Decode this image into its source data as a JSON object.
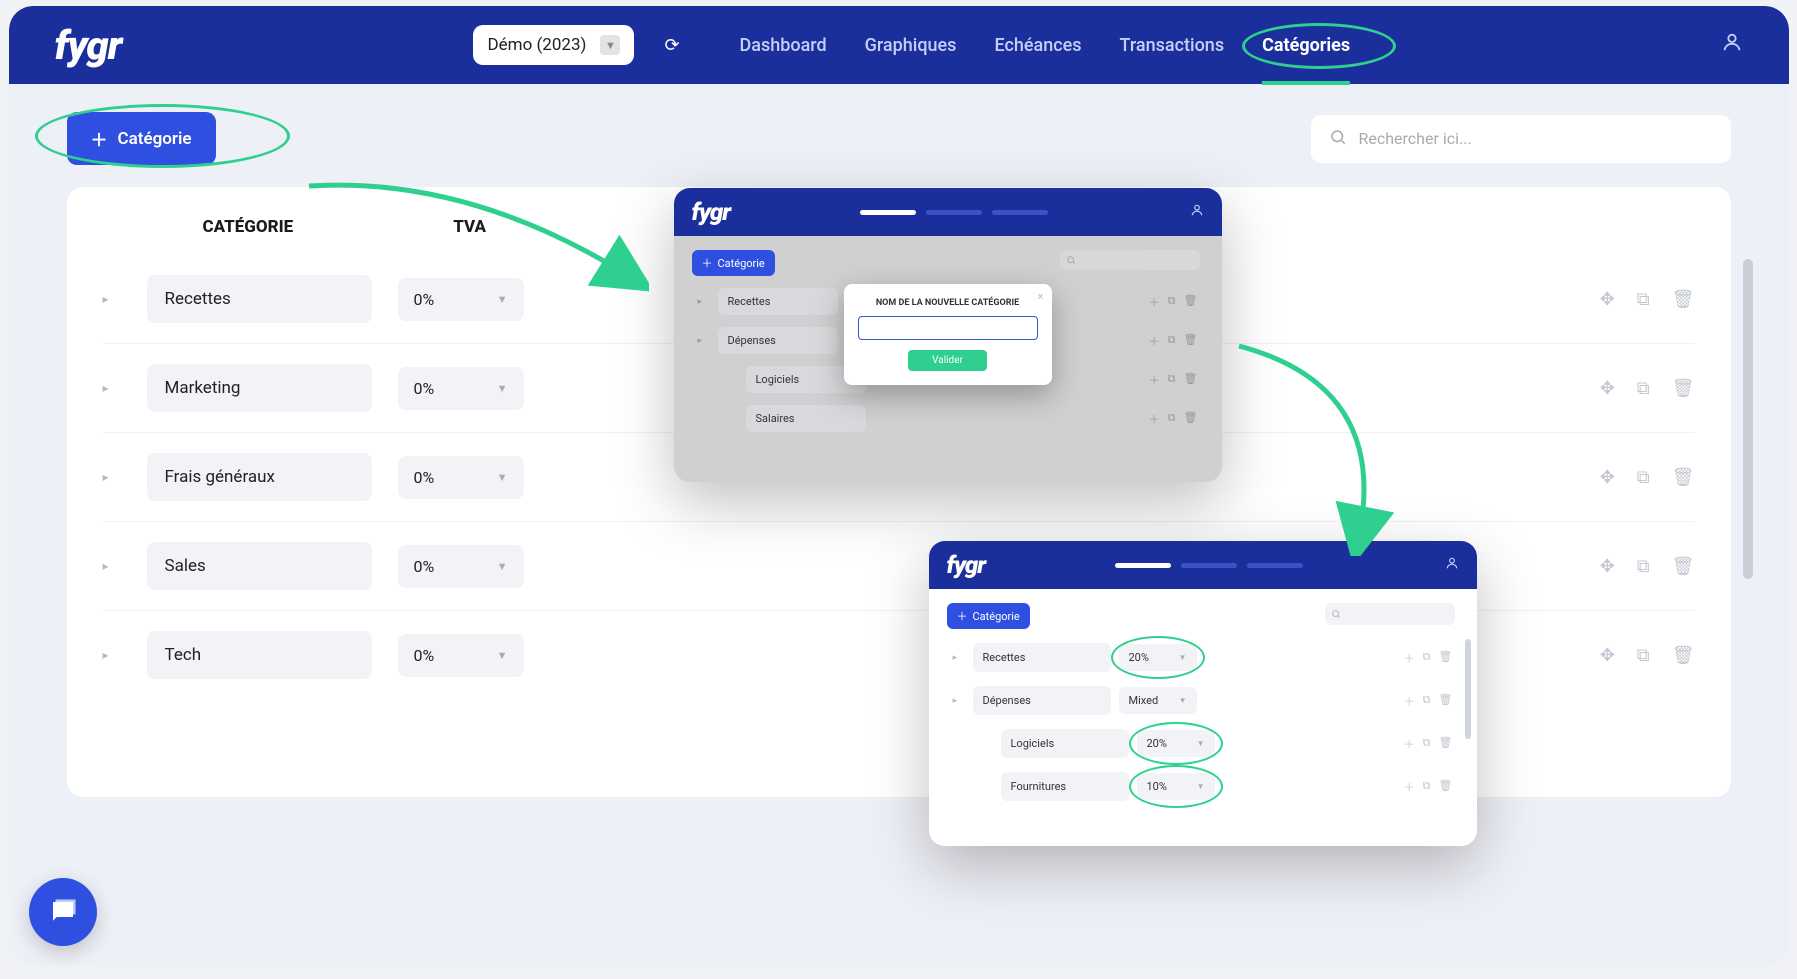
{
  "brand": "fygr",
  "demo_label": "Démo (2023)",
  "nav": [
    "Dashboard",
    "Graphiques",
    "Echéances",
    "Transactions",
    "Catégories"
  ],
  "add_btn": "Catégorie",
  "search_placeholder": "Rechercher ici...",
  "headers": {
    "cat": "CATÉGORIE",
    "tva": "TVA"
  },
  "rows": [
    {
      "name": "Recettes",
      "tva": "0%"
    },
    {
      "name": "Marketing",
      "tva": "0%"
    },
    {
      "name": "Frais généraux",
      "tva": "0%"
    },
    {
      "name": "Sales",
      "tva": "0%"
    },
    {
      "name": "Tech",
      "tva": "0%"
    }
  ],
  "modal": {
    "title": "NOM DE LA NOUVELLE CATÉGORIE",
    "submit": "Valider"
  },
  "mini1": {
    "add": "Catégorie",
    "cats": [
      "Recettes",
      "Dépenses"
    ],
    "subs": [
      "Logiciels",
      "Salaires"
    ]
  },
  "mini2": {
    "add": "Catégorie",
    "rows": [
      {
        "name": "Recettes",
        "tva": "20%",
        "circled": true
      },
      {
        "name": "Dépenses",
        "tva": "Mixed"
      }
    ],
    "subs": [
      {
        "name": "Logiciels",
        "tva": "20%",
        "circled": true
      },
      {
        "name": "Fournitures",
        "tva": "10%",
        "circled": true
      }
    ]
  }
}
